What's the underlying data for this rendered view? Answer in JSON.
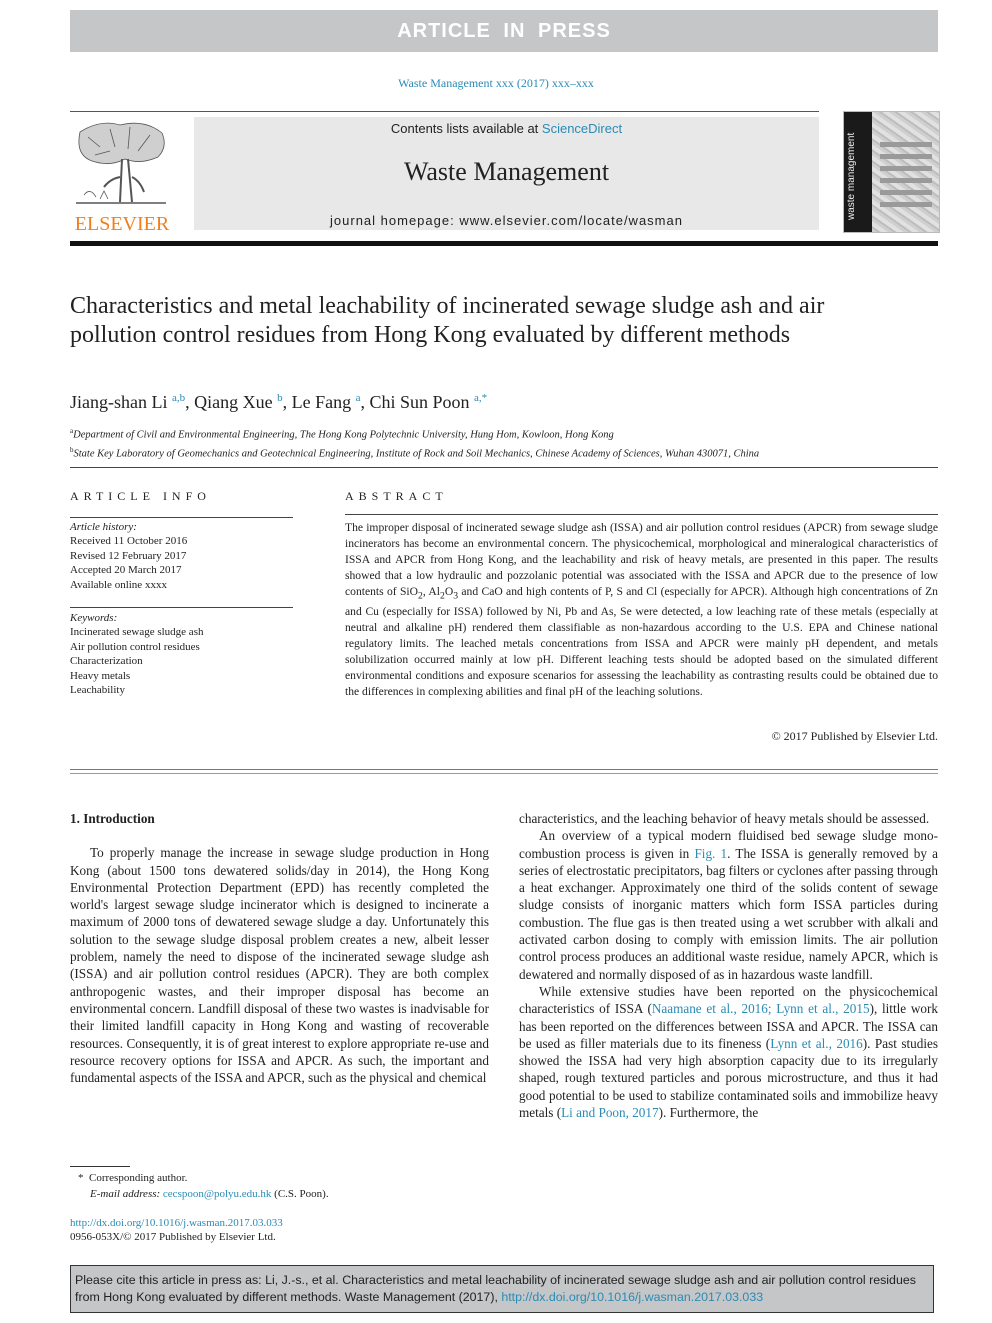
{
  "banner": {
    "label": "ARTICLE IN PRESS"
  },
  "journal_citation": "Waste Management xxx (2017) xxx–xxx",
  "header": {
    "publisher_logo": "ELSEVIER",
    "contents_prefix": "Contents lists available at ",
    "contents_link": "ScienceDirect",
    "journal_title": "Waste Management",
    "homepage_prefix": "journal homepage: ",
    "homepage_url": "www.elsevier.com/locate/wasman",
    "cover_spine": "waste management",
    "cover_icon": "journal-cover-image"
  },
  "article": {
    "title": "Characteristics and metal leachability of incinerated sewage sludge ash and air pollution control residues from Hong Kong evaluated by different methods",
    "authors": [
      {
        "name": "Jiang-shan Li",
        "sup": "a,b"
      },
      {
        "name": "Qiang Xue",
        "sup": "b"
      },
      {
        "name": "Le Fang",
        "sup": "a"
      },
      {
        "name": "Chi Sun Poon",
        "sup": "a,*"
      }
    ],
    "affiliations": [
      {
        "mark": "a",
        "text": "Department of Civil and Environmental Engineering, The Hong Kong Polytechnic University, Hung Hom, Kowloon, Hong Kong"
      },
      {
        "mark": "b",
        "text": "State Key Laboratory of Geomechanics and Geotechnical Engineering, Institute of Rock and Soil Mechanics, Chinese Academy of Sciences, Wuhan 430071, China"
      }
    ]
  },
  "article_info": {
    "heading": "ARTICLE INFO",
    "history_label": "Article history:",
    "history": [
      "Received 11 October 2016",
      "Revised 12 February 2017",
      "Accepted 20 March 2017",
      "Available online xxxx"
    ],
    "keywords_label": "Keywords:",
    "keywords": [
      "Incinerated sewage sludge ash",
      "Air pollution control residues",
      "Characterization",
      "Heavy metals",
      "Leachability"
    ]
  },
  "abstract": {
    "heading": "ABSTRACT",
    "part1": "The improper disposal of incinerated sewage sludge ash (ISSA) and air pollution control residues (APCR) from sewage sludge incinerators has become an environmental concern. The physicochemical, morphological and mineralogical characteristics of ISSA and APCR from Hong Kong, and the leachability and risk of heavy metals, are presented in this paper. The results showed that a low hydraulic and pozzolanic potential was associated with the ISSA and APCR due to the presence of low contents of SiO",
    "sio2_sub": "2",
    "part2": ", Al",
    "al_sub": "2",
    "part3": "O",
    "o_sub": "3",
    "part4": " and CaO and high contents of P, S and Cl (especially for APCR). Although high concentrations of Zn and Cu (especially for ISSA) followed by Ni, Pb and As, Se were detected, a low leaching rate of these metals (especially at neutral and alkaline pH) rendered them classifiable as non-hazardous according to the U.S. EPA and Chinese national regulatory limits. The leached metals concentrations from ISSA and APCR were mainly pH dependent, and metals solubilization occurred mainly at low pH. Different leaching tests should be adopted based on the simulated different environmental conditions and exposure scenarios for assessing the leachability as contrasting results could be obtained due to the differences in complexing abilities and final pH of the leaching solutions.",
    "copyright": "© 2017 Published by Elsevier Ltd."
  },
  "intro": {
    "heading": "1. Introduction",
    "p1": "To properly manage the increase in sewage sludge production in Hong Kong (about 1500 tons dewatered solids/day in 2014), the Hong Kong Environmental Protection Department (EPD) has recently completed the world's largest sewage sludge incinerator which is designed to incinerate a maximum of 2000 tons of dewatered sewage sludge a day. Unfortunately this solution to the sewage sludge disposal problem creates a new, albeit lesser problem, namely the need to dispose of the incinerated sewage sludge ash (ISSA) and air pollution control residues (APCR). They are both complex anthropogenic wastes, and their improper disposal has become an environmental concern. Landfill disposal of these two wastes is inadvisable for their limited landfill capacity in Hong Kong and wasting of recoverable resources. Consequently, it is of great interest to explore appropriate re-use and resource recovery options for ISSA and APCR. As such, the important and fundamental aspects of the ISSA and APCR, such as the physical and chemical",
    "p1_cont": "characteristics, and the leaching behavior of heavy metals should be assessed.",
    "p2_a": "An overview of a typical modern fluidised bed sewage sludge mono-combustion process is given in ",
    "p2_link": "Fig. 1",
    "p2_b": ". The ISSA is generally removed by a series of electrostatic precipitators, bag filters or cyclones after passing through a heat exchanger. Approximately one third of the solids content of sewage sludge consists of inorganic matters which form ISSA particles during combustion. The flue gas is then treated using a wet scrubber with alkali and activated carbon dosing to comply with emission limits. The air pollution control process produces an additional waste residue, namely APCR, which is dewatered and normally disposed of as in hazardous waste landfill.",
    "p3_a": "While extensive studies have been reported on the physicochemical characteristics of ISSA (",
    "p3_link1": "Naamane et al., 2016; Lynn et al., 2015",
    "p3_b": "), little work has been reported on the differences between ISSA and APCR. The ISSA can be used as filler materials due to its fineness (",
    "p3_link2": "Lynn et al., 2016",
    "p3_c": "). Past studies showed the ISSA had very high absorption capacity due to its irregularly shaped, rough textured particles and porous microstructure, and thus it had good potential to be used to stabilize contaminated soils and immobilize heavy metals (",
    "p3_link3": "Li and Poon, 2017",
    "p3_d": "). Furthermore, the"
  },
  "footnote": {
    "star": "*",
    "corresponding": "Corresponding author.",
    "email_label": "E-mail address:",
    "email": "cecspoon@polyu.edu.hk",
    "email_suffix": " (C.S. Poon)."
  },
  "doi": {
    "url": "http://dx.doi.org/10.1016/j.wasman.2017.03.033",
    "issn": "0956-053X/© 2017 Published by Elsevier Ltd."
  },
  "cite_box": {
    "text": "Please cite this article in press as: Li, J.-s., et al. Characteristics and metal leachability of incinerated sewage sludge ash and air pollution control residues from Hong Kong evaluated by different methods. Waste Management (2017), ",
    "link": "http://dx.doi.org/10.1016/j.wasman.2017.03.033"
  }
}
